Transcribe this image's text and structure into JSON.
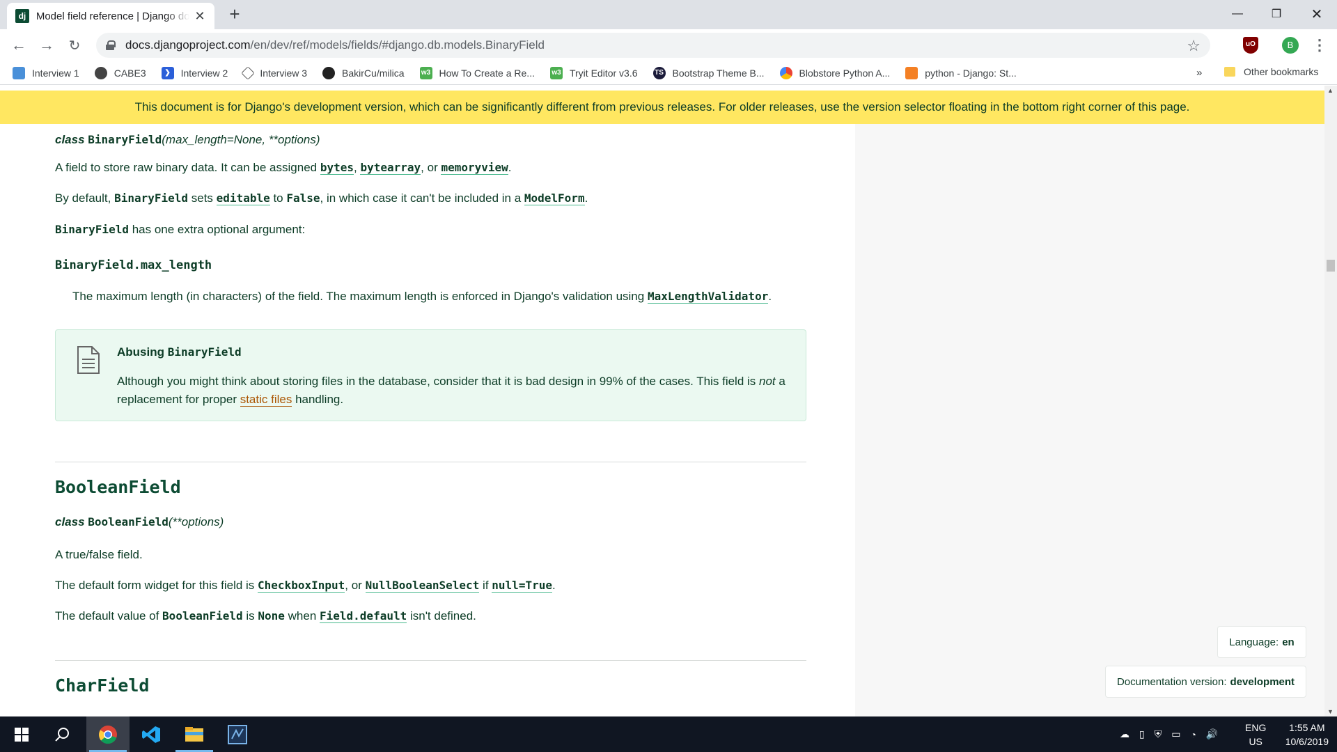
{
  "browser": {
    "tab_title": "Model field reference | Django documentation",
    "favicon_text": "dj",
    "url_host": "docs.djangoproject.com",
    "url_path": "/en/dev/ref/models/fields/#django.db.models.BinaryField",
    "avatar_letter": "B",
    "ublock_label": "uO",
    "bookmarks": [
      {
        "label": "Interview 1",
        "icon": "interview-icon",
        "color": "#4a90d9"
      },
      {
        "label": "CABE3",
        "icon": "globe-icon",
        "color": "#444444"
      },
      {
        "label": "Interview 2",
        "icon": "interview-icon",
        "color": "#2b5fd9"
      },
      {
        "label": "Interview 3",
        "icon": "diamond-icon",
        "color": "#555555"
      },
      {
        "label": "BakirCu/milica",
        "icon": "github-icon",
        "color": "#222222"
      },
      {
        "label": "How To Create a Re...",
        "icon": "w3-icon",
        "color": "#4caf50"
      },
      {
        "label": "Tryit Editor v3.6",
        "icon": "w3-icon",
        "color": "#4caf50"
      },
      {
        "label": "Bootstrap Theme B...",
        "icon": "ts-icon",
        "color": "#1b1b3a"
      },
      {
        "label": "Blobstore Python A...",
        "icon": "cloud-icon",
        "color": "#4285f4"
      },
      {
        "label": "python - Django: St...",
        "icon": "stackoverflow-icon",
        "color": "#f48024"
      }
    ],
    "bookmarks_more": "»",
    "other_bookmarks": "Other bookmarks"
  },
  "banner": {
    "text": "This document is for Django's development version, which can be significantly different from previous releases. For older releases, use the version selector floating in the bottom right corner of this page."
  },
  "binaryfield": {
    "sig_class": "class",
    "sig_name": "BinaryField",
    "sig_args": "(max_length=None, **options)",
    "p1_a": "A field to store raw binary data. It can be assigned ",
    "p1_bytes": "bytes",
    "p1_comma": ", ",
    "p1_bytearray": "bytearray",
    "p1_or": ", or ",
    "p1_memoryview": "memoryview",
    "p1_end": ".",
    "p2_a": "By default, ",
    "p2_name": "BinaryField",
    "p2_b": " sets ",
    "p2_editable": "editable",
    "p2_c": " to ",
    "p2_false": "False",
    "p2_d": ", in which case it can't be included in a ",
    "p2_modelform": "ModelForm",
    "p2_end": ".",
    "p3_name": "BinaryField",
    "p3_text": " has one extra optional argument:",
    "attr_name": "BinaryField.max_length",
    "attr_desc": "The maximum length (in characters) of the field. The maximum length is enforced in Django's validation using ",
    "attr_validator": "MaxLengthValidator",
    "attr_end": "."
  },
  "note": {
    "title_a": "Abusing ",
    "title_code": "BinaryField",
    "body_a": "Although you might think about storing files in the database, consider that it is bad design in 99% of the cases. This field is ",
    "body_not": "not",
    "body_b": " a replacement for proper ",
    "body_link": "static files",
    "body_end": " handling."
  },
  "booleanfield": {
    "heading": "BooleanField",
    "sig_class": "class",
    "sig_name": "BooleanField",
    "sig_args": "(**options)",
    "p1": "A true/false field.",
    "p2_a": "The default form widget for this field is ",
    "p2_checkbox": "CheckboxInput",
    "p2_or": ", or ",
    "p2_nullselect": "NullBooleanSelect",
    "p2_if": " if ",
    "p2_null": "null=True",
    "p2_end": ".",
    "p3_a": "The default value of ",
    "p3_name": "BooleanField",
    "p3_is": " is ",
    "p3_none": "None",
    "p3_when": " when ",
    "p3_default": "Field.default",
    "p3_end": " isn't defined."
  },
  "charfield": {
    "heading": "CharField"
  },
  "floating": {
    "language_label": "Language:",
    "language_value": "en",
    "version_label": "Documentation version:",
    "version_value": "development"
  },
  "taskbar": {
    "lang_top": "ENG",
    "lang_bottom": "US",
    "time": "1:55 AM",
    "date": "10/6/2019"
  },
  "colors": {
    "django_green": "#0c4b33",
    "banner_yellow": "#ffe761",
    "note_bg": "#ebf9f1",
    "link_underline": "#44b78b",
    "taskbar": "#101622"
  }
}
